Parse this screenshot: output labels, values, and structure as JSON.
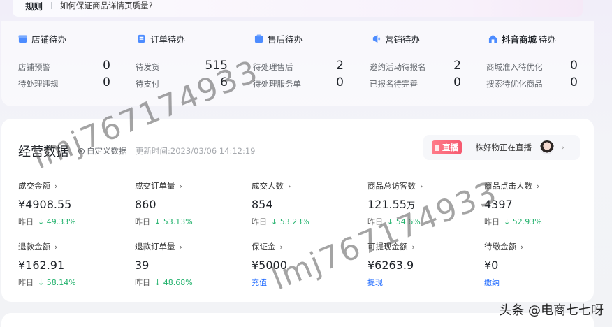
{
  "banner": {
    "tag": "规则",
    "text": "如何保证商品详情页质量?"
  },
  "todos": [
    {
      "icon": "store-icon",
      "title": "店铺待办",
      "brand": "",
      "rows": [
        {
          "label": "店铺预警",
          "value": "0"
        },
        {
          "label": "待处理违规",
          "value": "0"
        }
      ]
    },
    {
      "icon": "order-icon",
      "title": "订单待办",
      "brand": "",
      "rows": [
        {
          "label": "待发货",
          "value": "515"
        },
        {
          "label": "待支付",
          "value": "6"
        }
      ]
    },
    {
      "icon": "aftersale-icon",
      "title": "售后待办",
      "brand": "",
      "rows": [
        {
          "label": "待处理售后",
          "value": "2"
        },
        {
          "label": "待处理服务单",
          "value": "0"
        }
      ]
    },
    {
      "icon": "megaphone-icon",
      "title": "营销待办",
      "brand": "",
      "rows": [
        {
          "label": "邀约活动待报名",
          "value": "2"
        },
        {
          "label": "已报名待完善",
          "value": "0"
        }
      ]
    },
    {
      "icon": "mall-icon",
      "title": "待办",
      "brand": "抖音商城",
      "rows": [
        {
          "label": "商城准入待优化",
          "value": "0"
        },
        {
          "label": "搜索待优化商品",
          "value": "0"
        }
      ]
    }
  ],
  "ops": {
    "title": "经营数据",
    "custom_label": "自定义数据",
    "update_time": "更新时间:2023/03/06 14:12:19",
    "live": {
      "badge": "直播",
      "text": "一株好物正在直播"
    },
    "metrics_row1": [
      {
        "label": "成交金额",
        "value": "¥4908.55",
        "unit": "",
        "sub_label": "昨日",
        "change": "↓ 49.33%"
      },
      {
        "label": "成交订单量",
        "value": "860",
        "unit": "",
        "sub_label": "昨日",
        "change": "↓ 53.13%"
      },
      {
        "label": "成交人数",
        "value": "854",
        "unit": "",
        "sub_label": "昨日",
        "change": "↓ 53.23%"
      },
      {
        "label": "商品总访客数",
        "value": "121.55",
        "unit": "万",
        "sub_label": "昨日",
        "change": "↓ 54.6%"
      },
      {
        "label": "商品点击人数",
        "value": "4397",
        "unit": "",
        "sub_label": "昨日",
        "change": "↓ 52.93%"
      }
    ],
    "metrics_row2": [
      {
        "label": "退款金额",
        "value": "¥162.91",
        "sub_label": "昨日",
        "change": "↓ 58.14%",
        "link": ""
      },
      {
        "label": "退款订单量",
        "value": "39",
        "sub_label": "昨日",
        "change": "↓ 48.68%",
        "link": ""
      },
      {
        "label": "保证金",
        "value": "¥5000",
        "sub_label": "",
        "change": "",
        "link": "充值"
      },
      {
        "label": "可提现金额",
        "value": "¥6263.9",
        "sub_label": "",
        "change": "",
        "link": "提现"
      },
      {
        "label": "待缴金额",
        "value": "¥0",
        "sub_label": "",
        "change": "",
        "link": "缴纳"
      }
    ]
  },
  "watermark": "lmj767174933",
  "footer_watermark": "头条 @电商七七呀",
  "colors": {
    "accent": "#1966ff",
    "down": "#23b26d",
    "live": "#f65a70"
  }
}
